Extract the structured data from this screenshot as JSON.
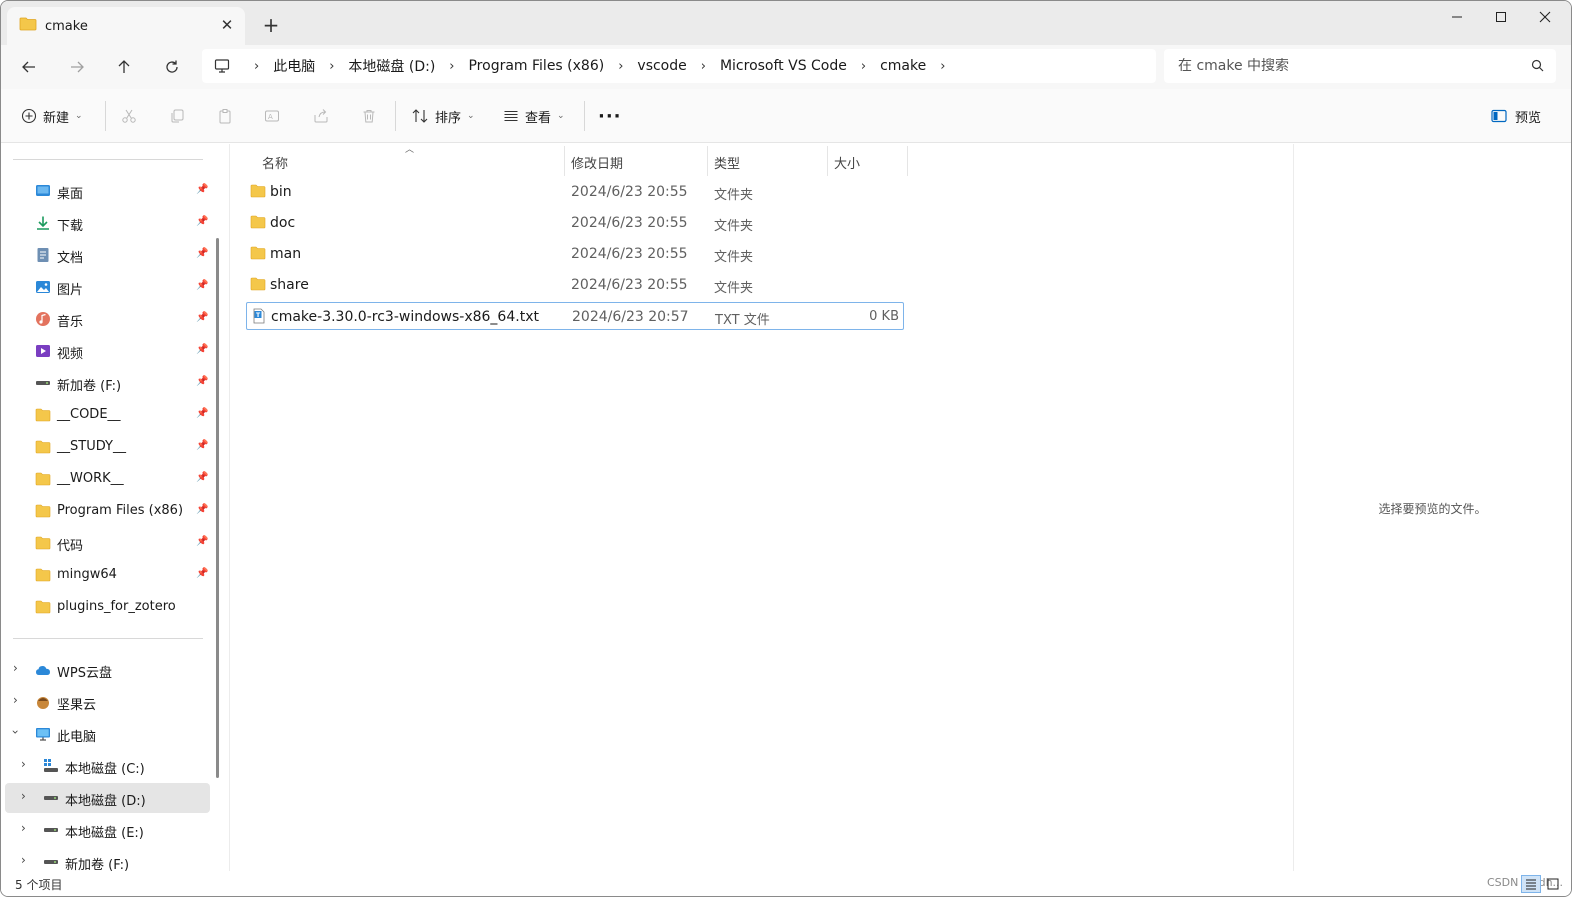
{
  "window": {
    "tab_title": "cmake",
    "colors": {
      "accent": "#0067c0",
      "folder": "#f4c74a",
      "folder_dark": "#e6a821"
    }
  },
  "address": {
    "crumbs": [
      "此电脑",
      "本地磁盘 (D:)",
      "Program Files (x86)",
      "vscode",
      "Microsoft VS Code",
      "cmake"
    ],
    "search_placeholder": "在 cmake 中搜索"
  },
  "toolbar": {
    "new_label": "新建",
    "sort_label": "排序",
    "view_label": "查看",
    "more_label": "···",
    "preview_label": "预览"
  },
  "sidebar": {
    "quick_access": [
      {
        "label": "桌面",
        "icon": "desktop-icon"
      },
      {
        "label": "下载",
        "icon": "download-icon"
      },
      {
        "label": "文档",
        "icon": "document-icon"
      },
      {
        "label": "图片",
        "icon": "pictures-icon"
      },
      {
        "label": "音乐",
        "icon": "music-icon"
      },
      {
        "label": "视频",
        "icon": "videos-icon"
      },
      {
        "label": "新加卷 (F:)",
        "icon": "drive-icon"
      },
      {
        "label": "__CODE__",
        "icon": "folder-icon"
      },
      {
        "label": "__STUDY__",
        "icon": "folder-icon"
      },
      {
        "label": "__WORK__",
        "icon": "folder-icon"
      },
      {
        "label": "Program Files (x86)",
        "icon": "folder-icon"
      },
      {
        "label": "代码",
        "icon": "folder-icon"
      },
      {
        "label": "mingw64",
        "icon": "folder-icon"
      },
      {
        "label": "plugins_for_zotero",
        "icon": "folder-icon"
      }
    ],
    "locations": [
      {
        "label": "WPS云盘",
        "icon": "cloud-icon"
      },
      {
        "label": "坚果云",
        "icon": "nut-icon"
      },
      {
        "label": "此电脑",
        "icon": "computer-icon"
      }
    ],
    "drives": [
      {
        "label": "本地磁盘 (C:)",
        "icon": "windows-drive-icon"
      },
      {
        "label": "本地磁盘 (D:)",
        "icon": "drive-icon"
      },
      {
        "label": "本地磁盘 (E:)",
        "icon": "drive-icon"
      },
      {
        "label": "新加卷 (F:)",
        "icon": "drive-icon"
      }
    ]
  },
  "columns": {
    "name": "名称",
    "modified": "修改日期",
    "type": "类型",
    "size": "大小"
  },
  "files": [
    {
      "name": "bin",
      "modified": "2024/6/23 20:55",
      "type": "文件夹",
      "size": "",
      "kind": "folder"
    },
    {
      "name": "doc",
      "modified": "2024/6/23 20:55",
      "type": "文件夹",
      "size": "",
      "kind": "folder"
    },
    {
      "name": "man",
      "modified": "2024/6/23 20:55",
      "type": "文件夹",
      "size": "",
      "kind": "folder"
    },
    {
      "name": "share",
      "modified": "2024/6/23 20:55",
      "type": "文件夹",
      "size": "",
      "kind": "folder"
    },
    {
      "name": "cmake-3.30.0-rc3-windows-x86_64.txt",
      "modified": "2024/6/23 20:57",
      "type": "TXT 文件",
      "size": "0 KB",
      "kind": "txt"
    }
  ],
  "preview": {
    "message": "选择要预览的文件。"
  },
  "status": {
    "item_count": "5 个项目",
    "watermark": "CSDN @sdh..."
  }
}
